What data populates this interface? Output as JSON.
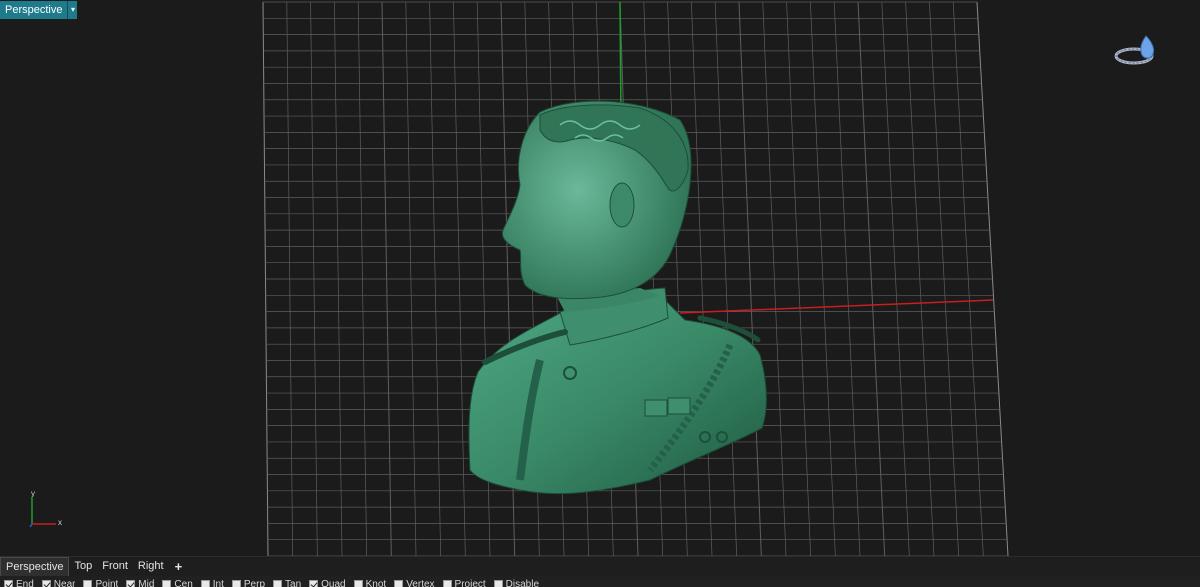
{
  "viewport": {
    "title": "Perspective",
    "title_menu_icon": "caret-down-icon",
    "axis_x_label": "x",
    "axis_y_label": "y",
    "navigation_widget_icon": "ring-with-gem-icon"
  },
  "tabs": [
    {
      "label": "Perspective",
      "active": true
    },
    {
      "label": "Top",
      "active": false
    },
    {
      "label": "Front",
      "active": false
    },
    {
      "label": "Right",
      "active": false
    }
  ],
  "add_tab_label": "+",
  "osnaps": [
    {
      "label": "End",
      "checked": true
    },
    {
      "label": "Near",
      "checked": true
    },
    {
      "label": "Point",
      "checked": false
    },
    {
      "label": "Mid",
      "checked": true
    },
    {
      "label": "Cen",
      "checked": false
    },
    {
      "label": "Int",
      "checked": false
    },
    {
      "label": "Perp",
      "checked": false
    },
    {
      "label": "Tan",
      "checked": false
    },
    {
      "label": "Quad",
      "checked": true
    },
    {
      "label": "Knot",
      "checked": false
    },
    {
      "label": "Vertex",
      "checked": false
    },
    {
      "label": "Project",
      "checked": false
    },
    {
      "label": "Disable",
      "checked": false
    }
  ],
  "colors": {
    "title_bg": "#1e7b8c",
    "grid": "#6b6b6b",
    "x_axis": "#c81e1e",
    "y_axis": "#1e9e2a",
    "model": "#3f8f6e"
  }
}
